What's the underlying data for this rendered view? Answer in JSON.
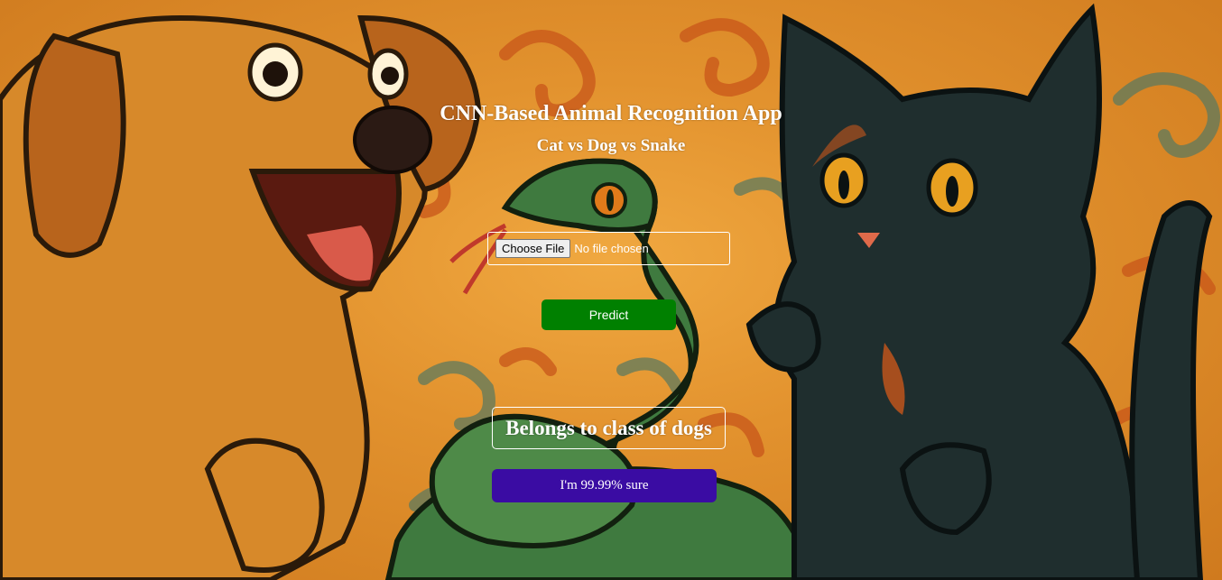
{
  "app": {
    "title": "CNN-Based Animal Recognition App",
    "subtitle": "Cat vs Dog vs Snake"
  },
  "upload": {
    "choose_label": "Choose File",
    "status": "No file chosen"
  },
  "predict": {
    "label": "Predict"
  },
  "result": {
    "text": "Belongs to class of dogs",
    "confidence": "I'm 99.99% sure"
  },
  "background": {
    "subjects": [
      "dog",
      "snake",
      "cat"
    ]
  },
  "colors": {
    "background_orange": "#e2922e",
    "predict_green": "#008000",
    "confidence_purple": "#3a0ca3",
    "text_white": "#ffffff"
  }
}
